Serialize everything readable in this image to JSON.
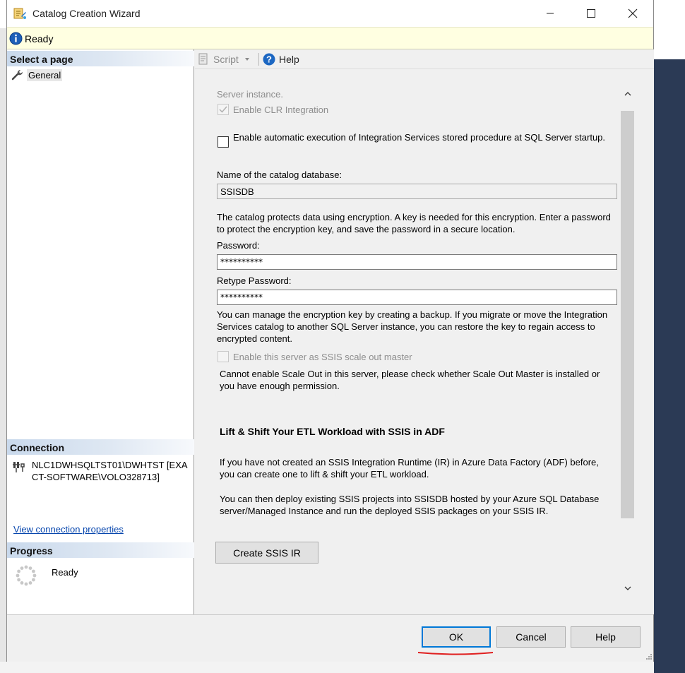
{
  "window": {
    "title": "Catalog Creation Wizard"
  },
  "infobar": {
    "status": "Ready"
  },
  "left": {
    "select_page_header": "Select a page",
    "pages": [
      {
        "label": "General",
        "icon": "wrench-icon"
      }
    ],
    "connection_header": "Connection",
    "connection_text": "NLC1DWHSQLTST01\\DWHTST [EXACT-SOFTWARE\\VOLO328713]",
    "connection_link": "View connection properties",
    "progress_header": "Progress",
    "progress_status": "Ready"
  },
  "toolbar": {
    "script_label": "Script",
    "help_label": "Help"
  },
  "content": {
    "cut_text": "Server instance.",
    "clr_label": "Enable CLR Integration",
    "clr_checked": true,
    "auto_exec_label": "Enable automatic execution of Integration Services stored procedure at SQL Server startup.",
    "auto_exec_checked": false,
    "db_name_label": "Name of the catalog database:",
    "db_name_value": "SSISDB",
    "encryption_text": "The catalog protects data using encryption. A key is needed for this encryption. Enter a password to protect the encryption key, and save the password in a secure location.",
    "password_label": "Password:",
    "password_value": "**********",
    "retype_label": "Retype Password:",
    "retype_value": "**********",
    "backup_text": "You can manage the encryption key by creating a backup. If you migrate or move the Integration Services catalog to another SQL Server instance, you can restore the key to regain access to encrypted content.",
    "scaleout_label": "Enable this server as SSIS scale out master",
    "scaleout_note": "Cannot enable Scale Out in this server, please check whether Scale Out Master is installed or you have enough permission.",
    "adf_heading": "Lift & Shift Your ETL Workload with SSIS in ADF",
    "adf_text1": "If you have not created an SSIS Integration Runtime (IR) in Azure Data Factory (ADF) before, you can create one to lift & shift your ETL workload.",
    "adf_text2": "You can then deploy existing SSIS projects into SSISDB hosted by your Azure SQL Database server/Managed Instance and run the deployed SSIS packages on your SSIS IR.",
    "create_ir_button": "Create SSIS IR"
  },
  "footer": {
    "ok": "OK",
    "cancel": "Cancel",
    "help": "Help"
  },
  "colors": {
    "accent": "#0078d7",
    "annotation": "#e02020"
  }
}
